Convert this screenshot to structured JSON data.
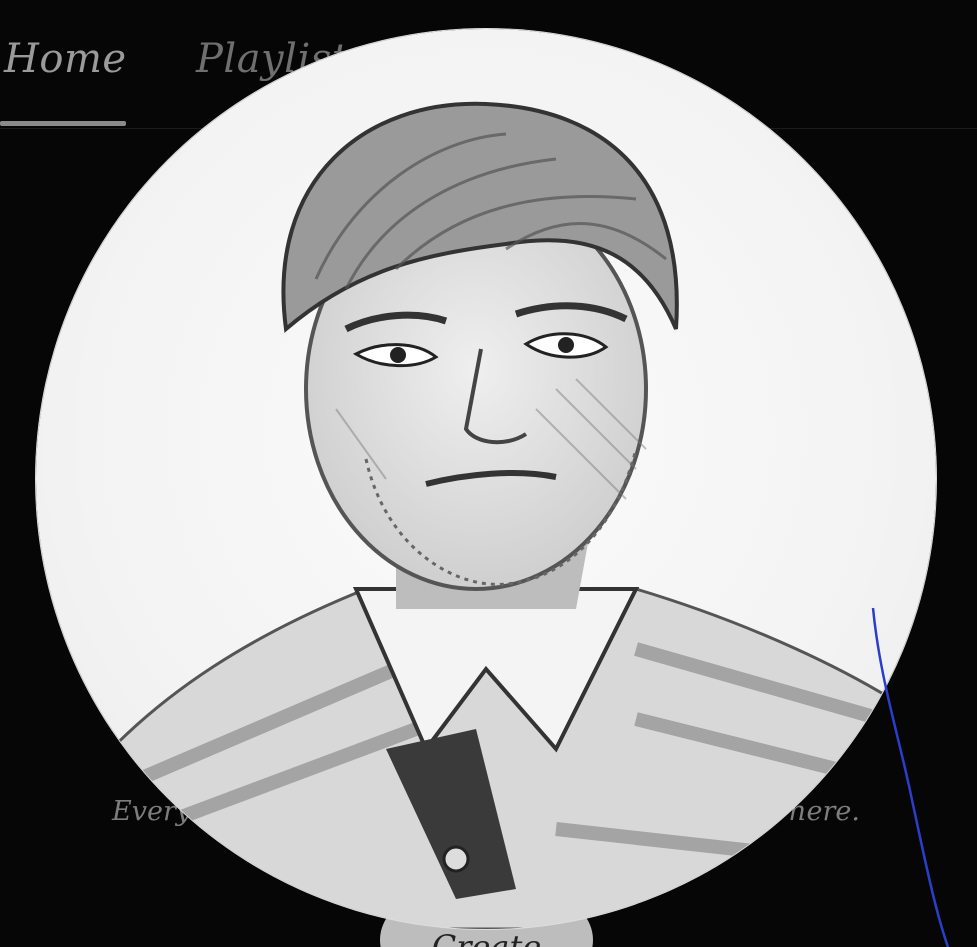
{
  "tabs": [
    {
      "label": "Home",
      "active": true
    },
    {
      "label": "Playlists",
      "active": false
    }
  ],
  "empty_state": {
    "text_left": "Every",
    "text_right": "here.",
    "create_label": "Create"
  },
  "profile": {
    "avatar_icon": "pencil-sketch-portrait"
  },
  "colors": {
    "background": "#060606",
    "tab_text": "#8a8a8a",
    "button_bg": "#bdbdbd",
    "pen_stroke": "#2a3fc9"
  }
}
